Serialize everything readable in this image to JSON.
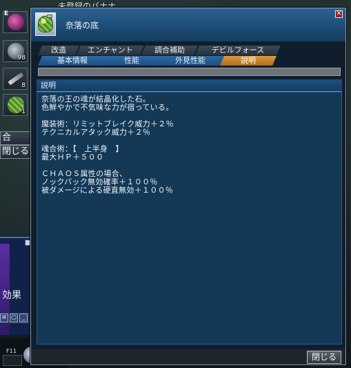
{
  "background": {
    "top_text": "未登録のバナナ",
    "left_slots": [
      {
        "tag": "E",
        "qty": ""
      },
      {
        "tag": "",
        "qty": "98"
      },
      {
        "tag": "",
        "qty": "8"
      },
      {
        "tag": "",
        "qty": "1"
      }
    ],
    "side_buttons": [
      "合",
      "閉じる"
    ],
    "mini_panel_label": "効果",
    "hotkey_label": "F11"
  },
  "window": {
    "title": "奈落の底",
    "close_glyph": "✕",
    "tabs_row1": [
      "改造",
      "エンチャント",
      "調合補助",
      "デビルフォース"
    ],
    "tabs_row2": [
      "基本情報",
      "性能",
      "外見性能",
      "説明"
    ],
    "active_tab": "説明",
    "section_title": "説明",
    "description": [
      "奈落の王の魂が結晶化した石。",
      "色鮮やかで不気味な力が宿っている。",
      "",
      "魔装術：リミットブレイク威力＋２％",
      "テクニカルアタック威力＋２％",
      "",
      "魂合術：【　上半身　】",
      "最大ＨＰ＋５００",
      "",
      "ＣＨＡＯＳ属性の場合、",
      "ノックバック無効確率＋１００％",
      "被ダメージによる硬直無効＋１００％"
    ],
    "close_button": "閉じる"
  },
  "colors": {
    "title_bar": "#1b4a74",
    "active_tab": "#d89a3e",
    "desc_panel": "#133957"
  }
}
